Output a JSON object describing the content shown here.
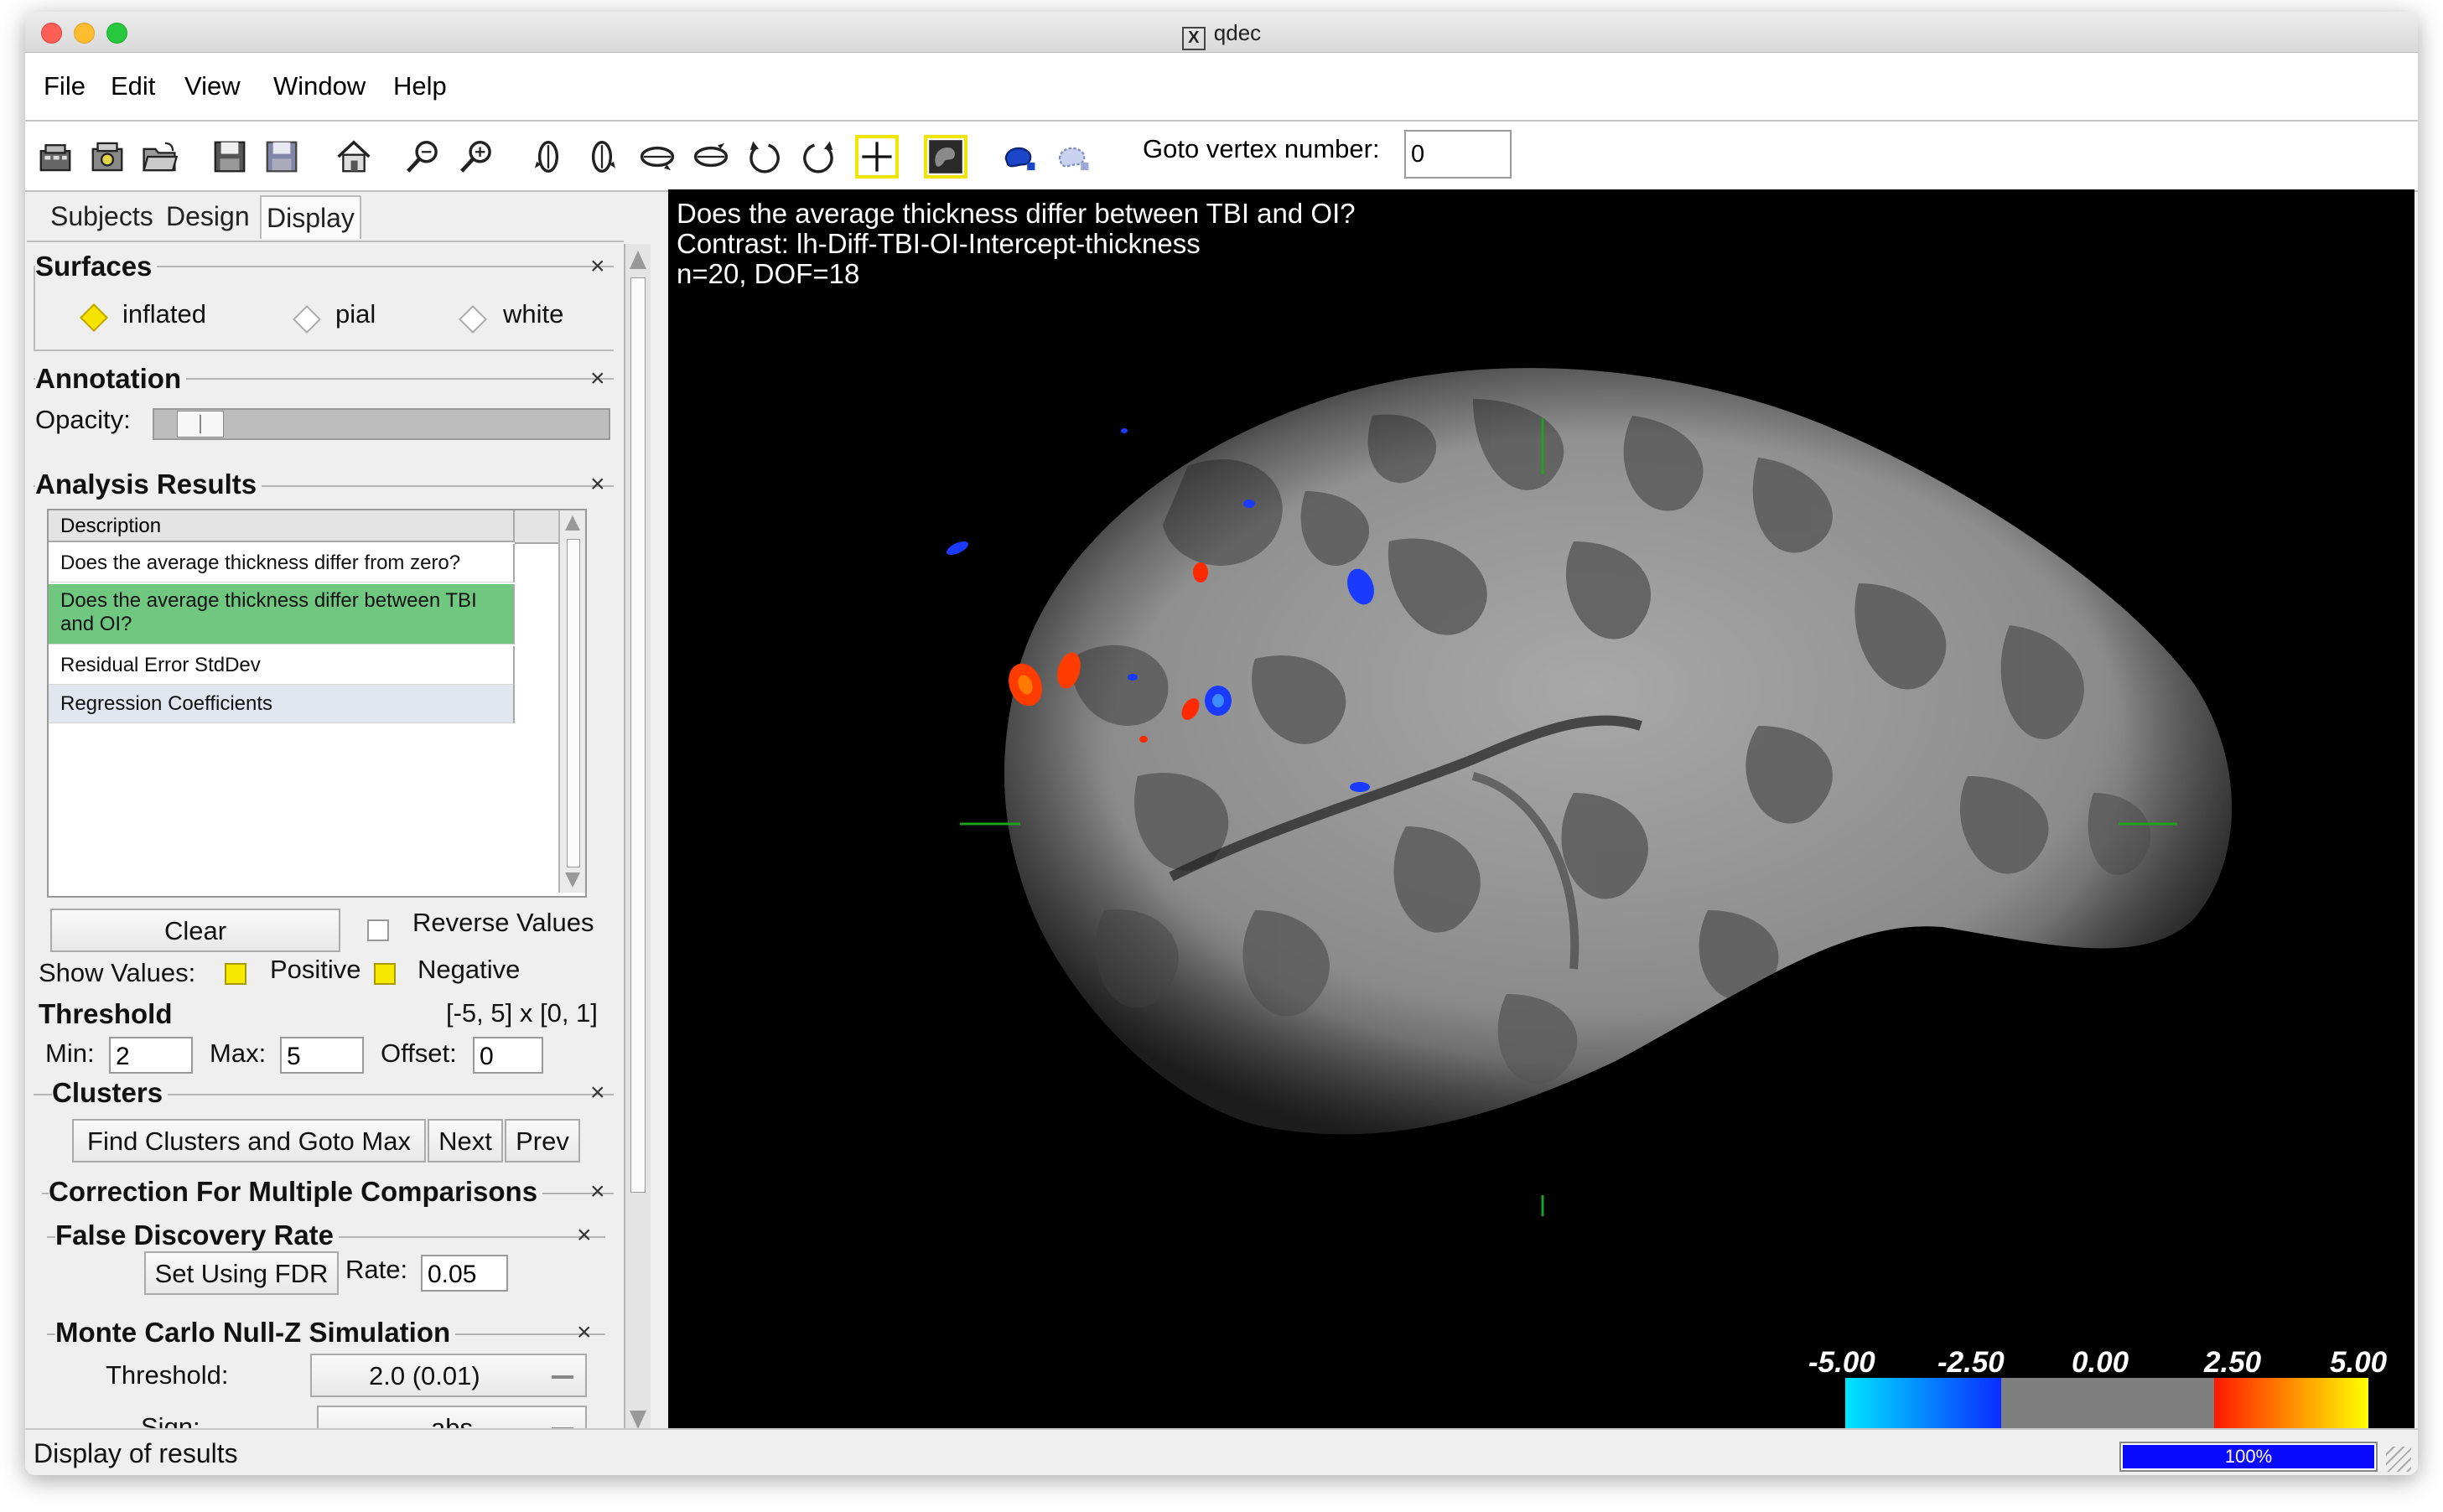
{
  "window": {
    "title": "qdec"
  },
  "menu": [
    "File",
    "Edit",
    "View",
    "Window",
    "Help"
  ],
  "toolbar": {
    "icons": [
      "load-subjects-icon",
      "load-data-icon",
      "open-folder-icon",
      "save-icon",
      "save-as-icon",
      "home-icon",
      "zoom-out-icon",
      "zoom-in-icon",
      "rotate-left-icon",
      "rotate-right-icon",
      "rotate-down-icon",
      "rotate-up-icon",
      "rotate-ccw-icon",
      "rotate-cw-icon",
      "cursor-crosshair-icon",
      "brain-view-icon",
      "select-label-icon",
      "deselect-label-icon"
    ],
    "goto_label": "Goto vertex number:",
    "goto_value": "0"
  },
  "tabs": [
    "Subjects",
    "Design",
    "Display"
  ],
  "surfaces": {
    "title": "Surfaces",
    "options": [
      "inflated",
      "pial",
      "white"
    ],
    "selected": "inflated"
  },
  "annotation": {
    "title": "Annotation",
    "opacity_label": "Opacity:",
    "opacity_level": 0.05
  },
  "analysis": {
    "title": "Analysis Results",
    "column": "Description",
    "rows": [
      "Does the average thickness differ from zero?",
      "Does the average thickness differ between TBI and OI?",
      "Residual Error StdDev",
      "Regression Coefficients"
    ],
    "clear_label": "Clear",
    "reverse_label": "Reverse Values",
    "show_values_label": "Show Values:",
    "positive_label": "Positive",
    "negative_label": "Negative"
  },
  "threshold": {
    "title": "Threshold",
    "range": "[-5, 5] x [0, 1]",
    "min_label": "Min:",
    "min": "2",
    "max_label": "Max:",
    "max": "5",
    "offset_label": "Offset:",
    "offset": "0"
  },
  "clusters": {
    "title": "Clusters",
    "find_label": "Find Clusters and Goto Max",
    "next_label": "Next",
    "prev_label": "Prev"
  },
  "correction": {
    "title": "Correction For Multiple Comparisons",
    "fdr_title": "False Discovery Rate",
    "fdr_button": "Set Using FDR",
    "rate_label": "Rate:",
    "rate": "0.05",
    "mc_title": "Monte Carlo Null-Z Simulation",
    "threshold_label": "Threshold:",
    "threshold_value": "2.0 (0.01)",
    "sign_label": "Sign:",
    "sign_value": "abs"
  },
  "viewport": {
    "line1": "Does the average thickness differ between TBI and OI?",
    "line2": "Contrast: lh-Diff-TBI-OI-Intercept-thickness",
    "line3": "n=20, DOF=18",
    "colorbar_labels": [
      "-5.00",
      "-2.50",
      "0.00",
      "2.50",
      "5.00"
    ],
    "colors": {
      "neg_low": "#00e5ff",
      "neg_high": "#0a2cff",
      "mid": "#7f7f7f",
      "pos_low": "#ff1a00",
      "pos_high": "#ffff00",
      "crosshair": "#1ea11e"
    }
  },
  "status": {
    "text": "Display of results",
    "progress_text": "100%",
    "progress": 1.0
  }
}
